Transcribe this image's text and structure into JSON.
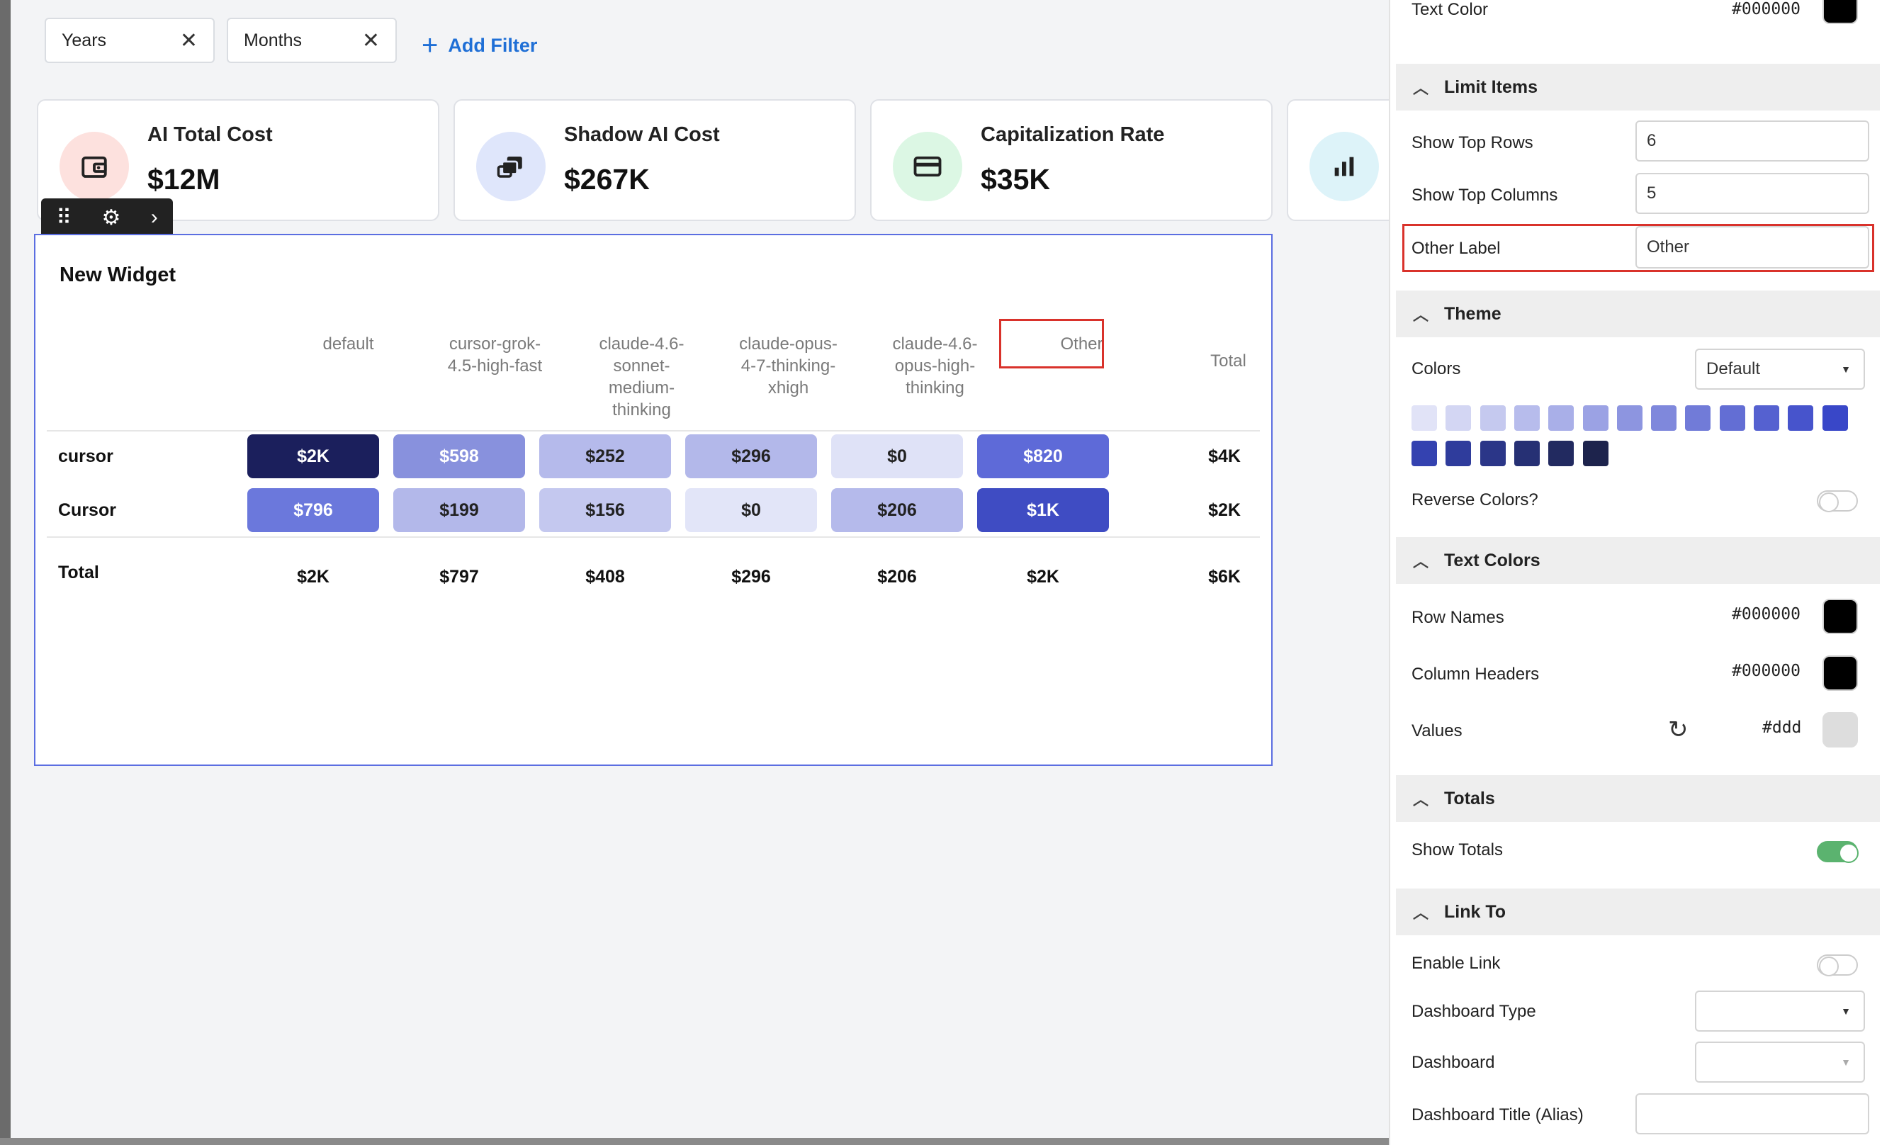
{
  "filters": {
    "chips": [
      {
        "label": "Years"
      },
      {
        "label": "Months"
      }
    ],
    "add_filter_label": "Add Filter"
  },
  "kpis": [
    {
      "title": "AI Total Cost",
      "value": "$12M",
      "icon": "wallet-icon",
      "color": "#fde1de"
    },
    {
      "title": "Shadow AI Cost",
      "value": "$267K",
      "icon": "copy-icon",
      "color": "#dfe6fb"
    },
    {
      "title": "Capitalization Rate",
      "value": "$35K",
      "icon": "credit-card-icon",
      "color": "#dcf7e4"
    },
    {
      "title": "",
      "value": "",
      "icon": "bar-chart-icon",
      "color": "#ddf3f9"
    }
  ],
  "widget": {
    "title": "New Widget",
    "columns": [
      "default",
      "cursor-grok-\n4.5-high-fast",
      "claude-4.6-\nsonnet-\nmedium-\nthinking",
      "claude-opus-\n4-7-thinking-\nxhigh",
      "claude-4.6-\nopus-high-\nthinking",
      "Other"
    ],
    "total_label": "Total",
    "rows": [
      {
        "name": "cursor",
        "values": [
          "$2K",
          "$598",
          "$252",
          "$296",
          "$0",
          "$820"
        ],
        "total": "$4K"
      },
      {
        "name": "Cursor",
        "values": [
          "$796",
          "$199",
          "$156",
          "$0",
          "$206",
          "$1K"
        ],
        "total": "$2K"
      }
    ],
    "totals_row": {
      "name": "Total",
      "values": [
        "$2K",
        "$797",
        "$408",
        "$296",
        "$206",
        "$2K"
      ],
      "total": "$6K"
    },
    "cell_colors": [
      [
        "#1b1f5c",
        "#8891dd",
        "#b5baeb",
        "#b3b8ea",
        "#dfe2f7",
        "#5e6ad8"
      ],
      [
        "#6b78dc",
        "#b3b8ea",
        "#c4c8ef",
        "#e2e5f8",
        "#b5baeb",
        "#3f4cc3"
      ]
    ],
    "cell_text_colors": [
      [
        "#ffffff",
        "#ffffff",
        "#222222",
        "#222222",
        "#222222",
        "#ffffff"
      ],
      [
        "#ffffff",
        "#222222",
        "#222222",
        "#222222",
        "#222222",
        "#ffffff"
      ]
    ]
  },
  "panel": {
    "text_color": {
      "label": "Text Color",
      "value": "#000000"
    },
    "limit_items": {
      "header": "Limit Items",
      "show_top_rows_label": "Show Top Rows",
      "show_top_rows_value": "6",
      "show_top_columns_label": "Show Top Columns",
      "show_top_columns_value": "5",
      "other_label_label": "Other Label",
      "other_label_value": "Other"
    },
    "theme": {
      "header": "Theme",
      "colors_label": "Colors",
      "colors_value": "Default",
      "swatches": [
        "#e1e3f7",
        "#d3d6f3",
        "#c5c9ef",
        "#b7bcec",
        "#a9afe8",
        "#9ba2e4",
        "#8d95e0",
        "#7f88dc",
        "#717bd8",
        "#636ed4",
        "#5561d0",
        "#4754cc",
        "#3947c8",
        "#3442b0",
        "#2f3c9c",
        "#2b3688",
        "#263074",
        "#222a60",
        "#1d234c"
      ],
      "reverse_label": "Reverse Colors?"
    },
    "text_colors": {
      "header": "Text Colors",
      "row_names_label": "Row Names",
      "row_names_value": "#000000",
      "column_headers_label": "Column Headers",
      "column_headers_value": "#000000",
      "values_label": "Values",
      "values_value": "#ddd"
    },
    "totals": {
      "header": "Totals",
      "show_totals_label": "Show Totals"
    },
    "link_to": {
      "header": "Link To",
      "enable_link_label": "Enable Link",
      "dashboard_type_label": "Dashboard Type",
      "dashboard_label": "Dashboard",
      "dashboard_title_label": "Dashboard Title (Alias)"
    }
  }
}
